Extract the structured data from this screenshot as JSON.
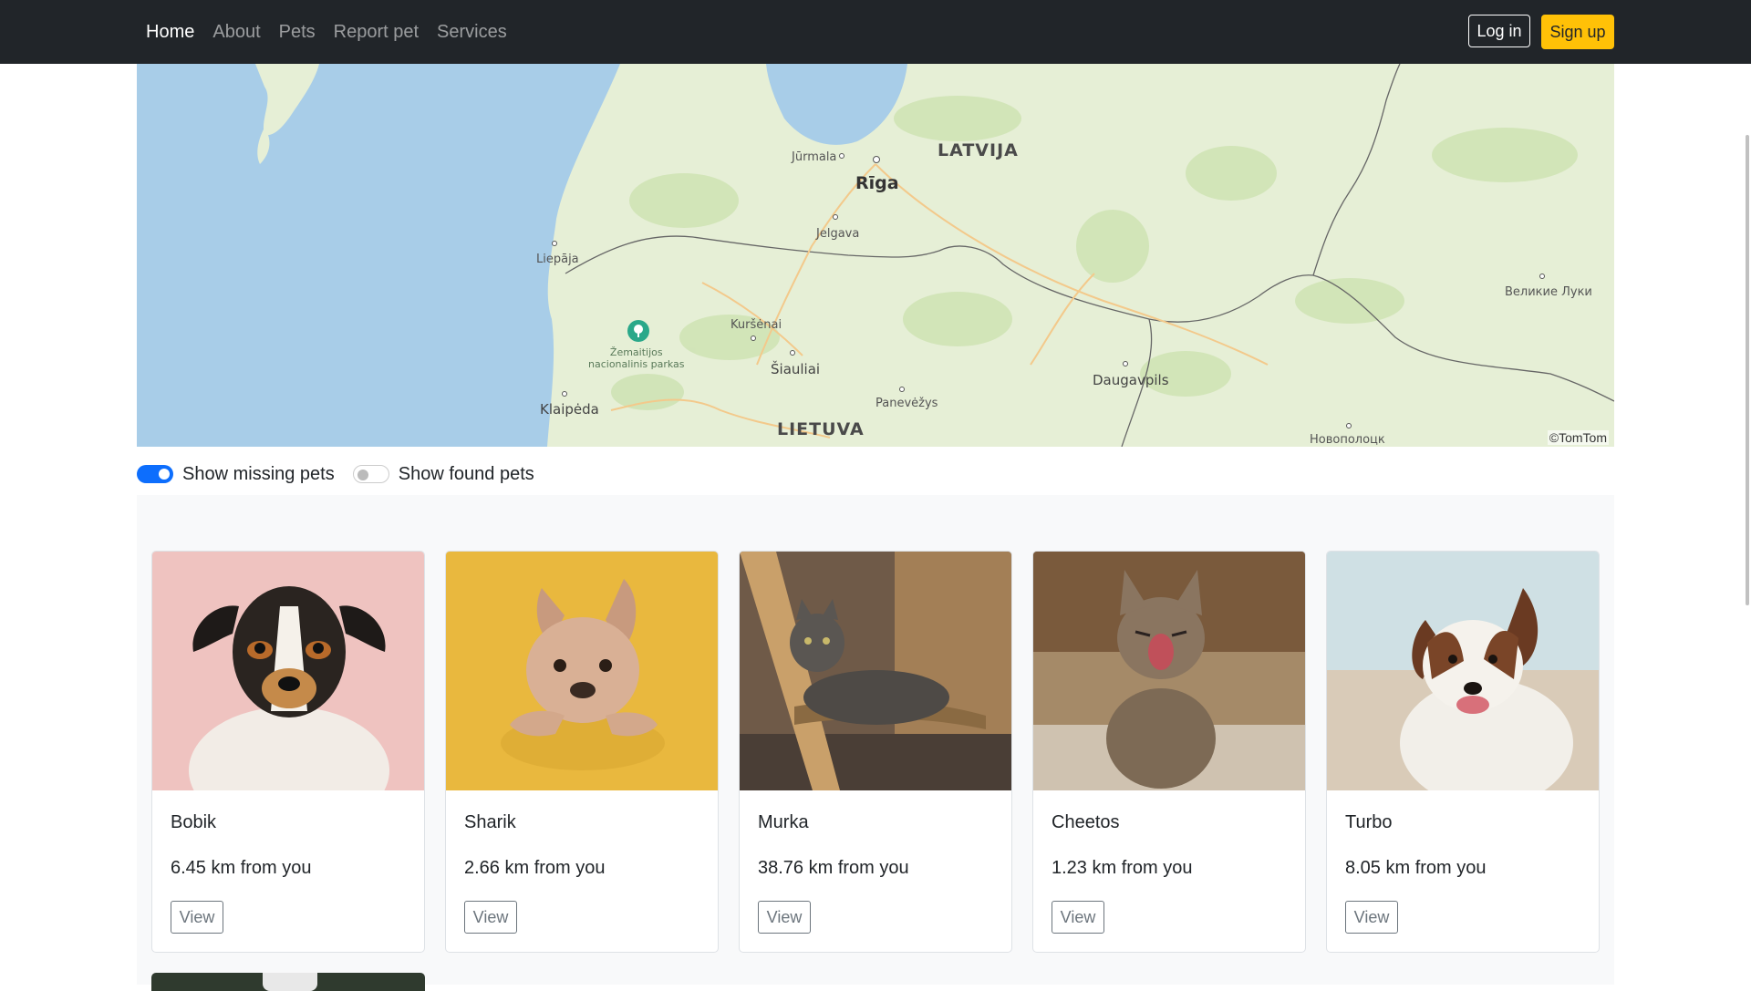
{
  "nav": {
    "links": [
      "Home",
      "About",
      "Pets",
      "Report pet",
      "Services"
    ],
    "login": "Log in",
    "signup": "Sign up"
  },
  "map": {
    "labels": {
      "latvija": "LATVIJA",
      "lietuva": "LIETUVA",
      "riga": "Rīga",
      "jurmala": "Jūrmala",
      "jelgava": "Jelgava",
      "liepaja": "Liepāja",
      "kursenai": "Kuršėnai",
      "siauliai": "Šiauliai",
      "panevezys": "Panevėžys",
      "klaipeda": "Klaipėda",
      "daugavpils": "Daugavpils",
      "velikie_luki": "Великие Луки",
      "novopolotsk": "Новополоцк",
      "park_line1": "Žemaitijos",
      "park_line2": "nacionalinis parkas"
    },
    "attribution": "©TomTom"
  },
  "filters": {
    "missing": {
      "label": "Show missing pets",
      "on": true
    },
    "found": {
      "label": "Show found pets",
      "on": false
    }
  },
  "pets": [
    {
      "name": "Bobik",
      "distance": "6.45 km from you",
      "button": "View",
      "photo": "dog-jack-russell"
    },
    {
      "name": "Sharik",
      "distance": "2.66 km from you",
      "button": "View",
      "photo": "dog-french-bulldog"
    },
    {
      "name": "Murka",
      "distance": "38.76 km from you",
      "button": "View",
      "photo": "cat-tabby-on-chair"
    },
    {
      "name": "Cheetos",
      "distance": "1.23 km from you",
      "button": "View",
      "photo": "cat-kitten-yawning"
    },
    {
      "name": "Turbo",
      "distance": "8.05 km from you",
      "button": "View",
      "photo": "dog-border-collie"
    }
  ],
  "colors": {
    "navbar": "#212529",
    "accent": "#ffc107",
    "toggle_on": "#0d6efd"
  }
}
